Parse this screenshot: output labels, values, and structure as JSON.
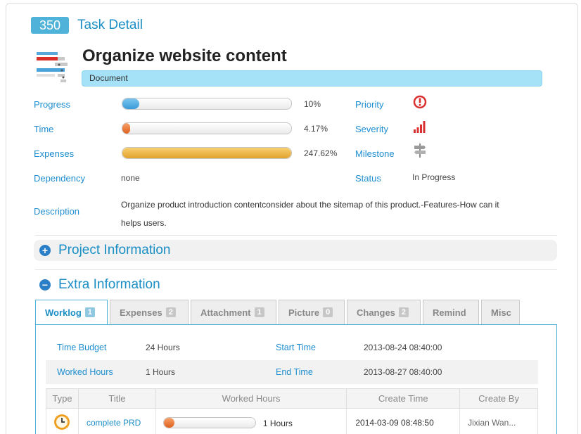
{
  "header": {
    "task_id": "350",
    "title": "Task Detail"
  },
  "task": {
    "name": "Organize website content",
    "type": "Document"
  },
  "metrics": {
    "progress": {
      "label": "Progress",
      "value": "10%",
      "fraction": 0.1
    },
    "time": {
      "label": "Time",
      "value": "4.17%",
      "fraction": 0.0417
    },
    "expenses": {
      "label": "Expenses",
      "value": "247.62%",
      "fraction": 1.0
    },
    "dependency": {
      "label": "Dependency",
      "value": "none"
    },
    "description": {
      "label": "Description",
      "value": "Organize product introduction contentconsider about the sitemap of this product.-Features-How can it helps users."
    }
  },
  "attributes": {
    "priority": {
      "label": "Priority",
      "icon": "priority-alert-icon"
    },
    "severity": {
      "label": "Severity",
      "icon": "signal-bars-icon"
    },
    "milestone": {
      "label": "Milestone",
      "icon": "signpost-icon"
    },
    "status": {
      "label": "Status",
      "value": "In Progress"
    }
  },
  "sections": {
    "project": {
      "title": "Project Information",
      "icon": "plus-circle-icon"
    },
    "extra": {
      "title": "Extra Information",
      "icon": "minus-circle-icon"
    }
  },
  "tabs": [
    {
      "label": "Worklog",
      "count": "1"
    },
    {
      "label": "Expenses",
      "count": "2"
    },
    {
      "label": "Attachment",
      "count": "1"
    },
    {
      "label": "Picture",
      "count": "0"
    },
    {
      "label": "Changes",
      "count": "2"
    },
    {
      "label": "Remind",
      "count": ""
    },
    {
      "label": "Misc",
      "count": ""
    }
  ],
  "worklog": {
    "time_budget": {
      "label": "Time Budget",
      "value": "24 Hours"
    },
    "start_time": {
      "label": "Start Time",
      "value": "2013-08-24 08:40:00"
    },
    "worked_hours": {
      "label": "Worked Hours",
      "value": "1 Hours"
    },
    "end_time": {
      "label": "End Time",
      "value": "2013-08-27 08:40:00"
    },
    "columns": [
      "Type",
      "Title",
      "Worked Hours",
      "Create Time",
      "Create By"
    ],
    "rows": [
      {
        "type_icon": "clock-icon",
        "title": "complete PRD",
        "worked_hours": "1 Hours",
        "hours_fraction": 0.04,
        "create_time": "2014-03-09 08:48:50",
        "create_by": "Jixian Wan..."
      }
    ]
  },
  "colors": {
    "accent": "#1a8ec5",
    "badge": "#4fb3d9",
    "type_bar": "#a5e2f7",
    "priority": "#d93030",
    "severity": "#d93030"
  }
}
